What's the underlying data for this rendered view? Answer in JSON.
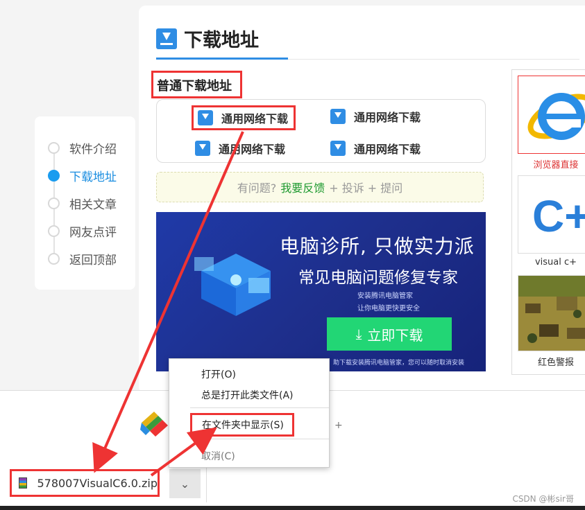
{
  "sidenav": {
    "items": [
      {
        "label": "软件介绍"
      },
      {
        "label": "下载地址"
      },
      {
        "label": "相关文章"
      },
      {
        "label": "网友点评"
      },
      {
        "label": "返回顶部"
      }
    ],
    "active": "下载地址"
  },
  "main": {
    "title": "下载地址",
    "subheading": "普通下载地址",
    "links": [
      {
        "label": "通用网络下载"
      },
      {
        "label": "通用网络下载"
      },
      {
        "label": "通用网络下载"
      },
      {
        "label": "通用网络下载"
      }
    ],
    "feedback": {
      "question": "有问题?",
      "feedback_link": "我要反馈",
      "complain": "+ 投诉 + 提问"
    }
  },
  "banner": {
    "headline": "电脑诊所, 只做实力派",
    "subline": "常见电脑问题修复专家",
    "small1": "安装腾讯电脑管家",
    "small2": "让你电脑更快更安全",
    "button": "立即下载",
    "footnote": "助下载安装腾讯电脑管家，您可以随时取消安装"
  },
  "right_col": {
    "items": [
      {
        "label": "浏览器直接",
        "icon": "ie-browser-icon"
      },
      {
        "label": "visual c+",
        "icon": "cpp-logo-icon"
      },
      {
        "label": "红色警报",
        "icon": "game-screenshot"
      }
    ]
  },
  "shelf": {
    "file_name": "578007VisualC6.0.zip",
    "plus": "+"
  },
  "context_menu": {
    "open": "打开(O)",
    "always_open": "总是打开此类文件(A)",
    "show_in_folder": "在文件夹中显示(S)",
    "cancel": "取消(C)"
  },
  "watermark": "CSDN @彬sir哥",
  "colors": {
    "accent": "#2f8de4",
    "highlight_red": "#e33",
    "green_button": "#22d675",
    "active_nav": "#1a9cef"
  }
}
